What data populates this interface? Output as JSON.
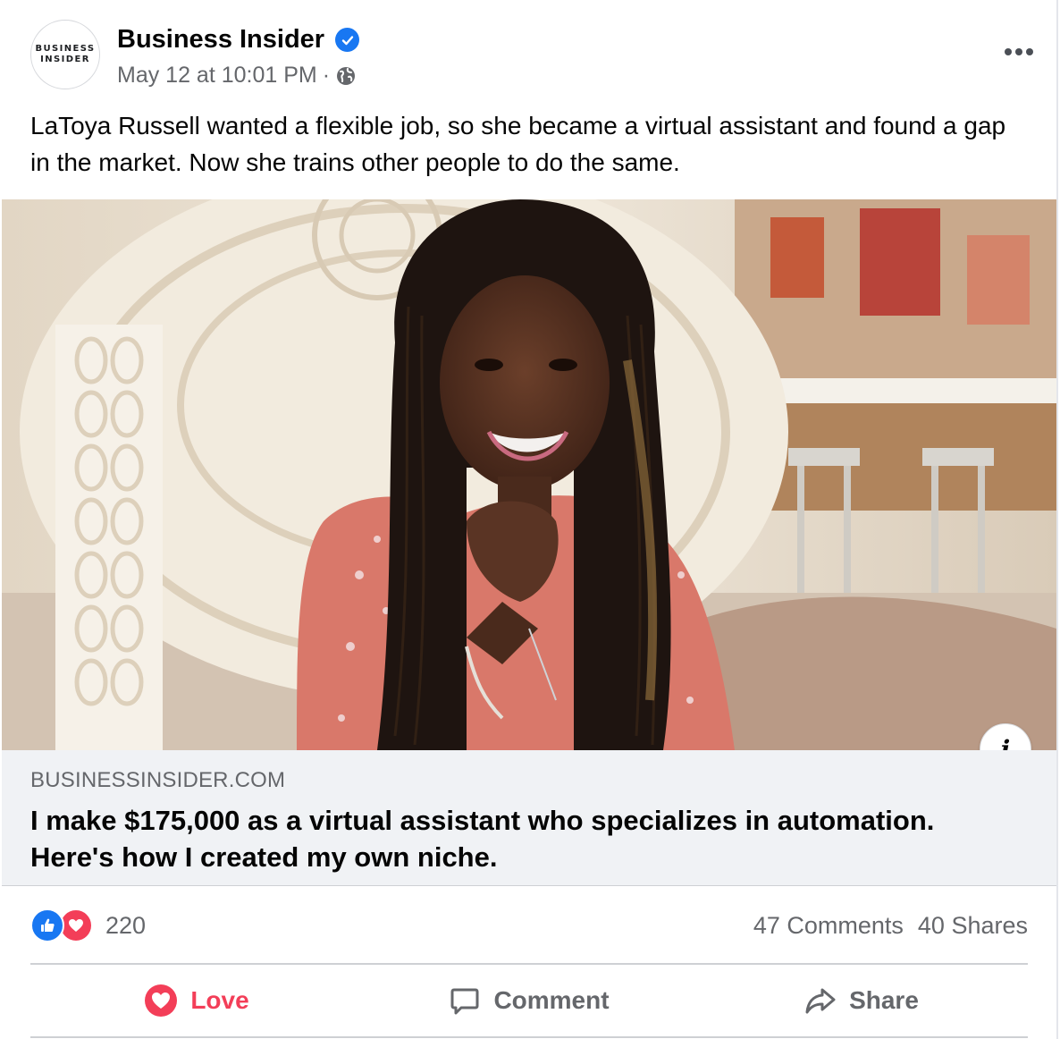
{
  "post": {
    "page_name": "Business Insider",
    "avatar_line1": "BUSINESS",
    "avatar_line2": "INSIDER",
    "timestamp": "May 12 at 10:01 PM",
    "separator": "·",
    "text": "LaToya Russell wanted a flexible job, so she became a virtual assistant and found a gap in the market. Now she trains other people to do the same."
  },
  "link_preview": {
    "domain": "BUSINESSINSIDER.COM",
    "headline": "I make $175,000 as a virtual assistant who specializes in automation. Here's how I created my own niche.",
    "info_label": "i"
  },
  "stats": {
    "reaction_count": "220",
    "comments": "47 Comments",
    "shares": "40 Shares"
  },
  "actions": {
    "love_label": "Love",
    "comment_label": "Comment",
    "share_label": "Share"
  },
  "colors": {
    "brand_blue": "#1877f2",
    "love_red": "#f33e58",
    "secondary_text": "#65676b",
    "link_bg": "#f0f2f5"
  },
  "icons": [
    "verified-icon",
    "globe-icon",
    "more-icon",
    "info-icon",
    "like-reaction-icon",
    "love-reaction-icon",
    "love-icon",
    "comment-icon",
    "share-icon"
  ]
}
